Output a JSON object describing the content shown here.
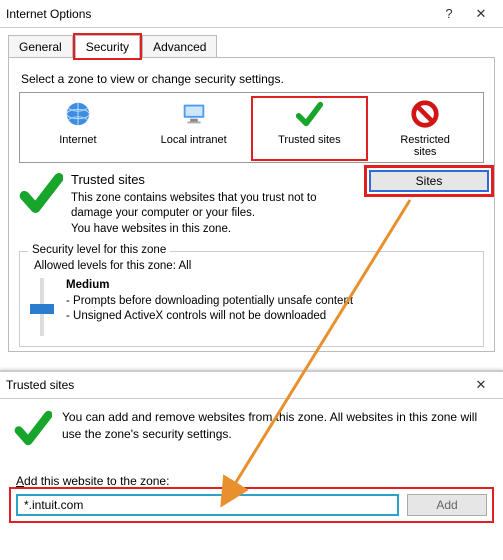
{
  "window": {
    "title": "Internet Options",
    "help_glyph": "?",
    "close_glyph": "✕"
  },
  "tabs": [
    {
      "label": "General",
      "active": false
    },
    {
      "label": "Security",
      "active": true
    },
    {
      "label": "Advanced",
      "active": false
    }
  ],
  "security": {
    "select_label": "Select a zone to view or change security settings.",
    "zones": [
      {
        "name": "Internet",
        "icon": "globe-icon"
      },
      {
        "name": "Local intranet",
        "icon": "computer-icon"
      },
      {
        "name": "Trusted sites",
        "icon": "checkmark-icon",
        "selected": true
      },
      {
        "name": "Restricted sites",
        "icon": "nosign-icon",
        "two_line": "Restricted\nsites"
      }
    ],
    "zone_detail": {
      "name": "Trusted sites",
      "line1": "This zone contains websites that you trust not to damage your computer or your files.",
      "line2": "You have websites in this zone."
    },
    "sites_button": "Sites",
    "level": {
      "caption": "Security level for this zone",
      "allowed": "Allowed levels for this zone: All",
      "level_name": "Medium",
      "bullet1": "- Prompts before downloading potentially unsafe content",
      "bullet2": "- Unsigned ActiveX controls will not be downloaded"
    }
  },
  "dialog2": {
    "title": "Trusted sites",
    "close_glyph": "✕",
    "description": "You can add and remove websites from this zone. All websites in this zone will use the zone's security settings.",
    "add_label_pre": "",
    "add_label": "Add this website to the zone:",
    "input_value": "*.intuit.com",
    "add_button": "Add"
  },
  "annotation": {
    "arrow_color": "#e8902e"
  }
}
